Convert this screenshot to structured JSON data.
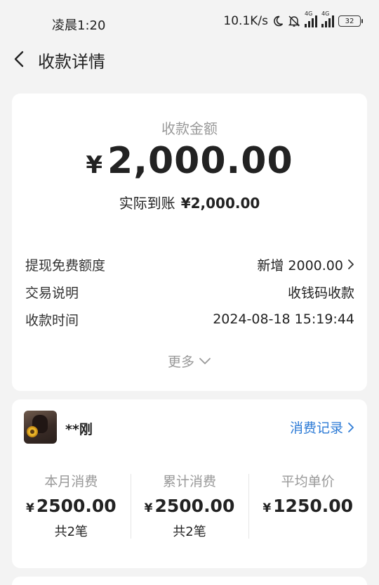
{
  "status_bar": {
    "time": "凌晨1:20",
    "speed": "10.1K/s",
    "net1": "4G",
    "net2": "4G",
    "battery": "32"
  },
  "nav": {
    "title": "收款详情"
  },
  "summary": {
    "amount_label": "收款金额",
    "currency": "¥",
    "amount": "2,000.00",
    "arrival_label": "实际到账",
    "arrival_value": "¥2,000.00"
  },
  "details": [
    {
      "key": "提现免费额度",
      "value": "新增 2000.00",
      "link": true
    },
    {
      "key": "交易说明",
      "value": "收钱码收款",
      "link": false
    },
    {
      "key": "收款时间",
      "value": "2024-08-18 15:19:44",
      "link": false
    }
  ],
  "more_label": "更多",
  "customer": {
    "name": "**刚",
    "record_link": "消费记录"
  },
  "stats": [
    {
      "label": "本月消费",
      "currency": "¥",
      "value": "2500.00",
      "count": "共2笔"
    },
    {
      "label": "累计消费",
      "currency": "¥",
      "value": "2500.00",
      "count": "共2笔"
    },
    {
      "label": "平均单价",
      "currency": "¥",
      "value": "1250.00",
      "count": ""
    }
  ],
  "colors": {
    "link": "#2d7bd6",
    "muted": "#999999",
    "background": "#f3f3f3"
  }
}
